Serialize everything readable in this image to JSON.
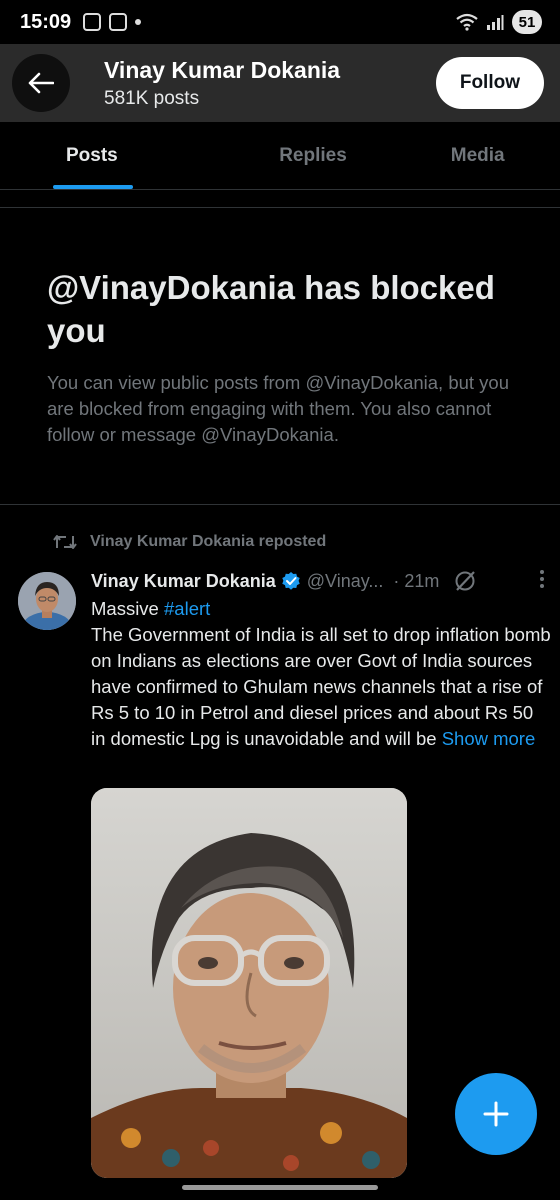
{
  "status_bar": {
    "time": "15:09",
    "battery": "51"
  },
  "header": {
    "name": "Vinay Kumar Dokania",
    "post_count": "581K posts",
    "follow_label": "Follow"
  },
  "tabs": [
    {
      "label": "Posts",
      "active": true
    },
    {
      "label": "Replies",
      "active": false
    },
    {
      "label": "Media",
      "active": false
    }
  ],
  "blocked": {
    "title": "@VinayDokania has blocked you",
    "body": "You can view public posts from @VinayDokania, but you are blocked from engaging with them. You also cannot follow or message @VinayDokania."
  },
  "post": {
    "repost_label": "Vinay Kumar Dokania reposted",
    "author_name": "Vinay Kumar Dokania",
    "handle": "@Vinay...",
    "time": "· 21m",
    "text_prefix": "Massive ",
    "hashtag": "#alert",
    "text_body": "The Government of India is all set to drop inflation bomb on Indians as elections are over Govt of India sources have confirmed to Ghulam news channels that a rise of Rs 5 to 10 in Petrol and diesel prices and about Rs 50 in domestic Lpg is unavoidable and will be ",
    "show_more": "Show more"
  },
  "colors": {
    "accent": "#1d9bf0",
    "muted": "#71767b",
    "text": "#e7e9ea",
    "header_bg": "#2b2b2b"
  },
  "icons": [
    "back-arrow-icon",
    "repost-icon",
    "verified-badge-icon",
    "grok-icon",
    "more-icon",
    "plus-icon"
  ]
}
